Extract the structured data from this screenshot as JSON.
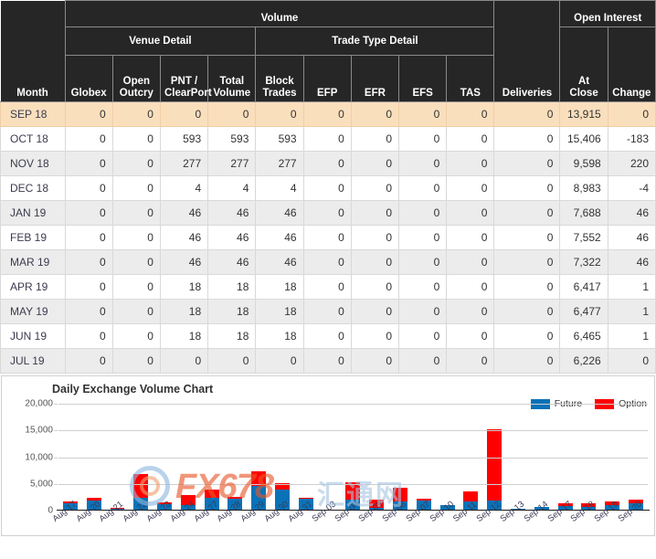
{
  "table": {
    "group_headers": {
      "volume": "Volume",
      "open_interest": "Open Interest",
      "venue_detail": "Venue Detail",
      "trade_type_detail": "Trade Type Detail"
    },
    "columns": [
      "Month",
      "Globex",
      "Open Outcry",
      "PNT / ClearPort",
      "Total Volume",
      "Block Trades",
      "EFP",
      "EFR",
      "EFS",
      "TAS",
      "Deliveries",
      "At Close",
      "Change"
    ],
    "rows": [
      {
        "style": "hl",
        "cells": [
          "SEP 18",
          "0",
          "0",
          "0",
          "0",
          "0",
          "0",
          "0",
          "0",
          "0",
          "0",
          "13,915",
          "0"
        ]
      },
      {
        "style": "even",
        "cells": [
          "OCT 18",
          "0",
          "0",
          "593",
          "593",
          "593",
          "0",
          "0",
          "0",
          "0",
          "0",
          "15,406",
          "-183"
        ]
      },
      {
        "style": "odd",
        "cells": [
          "NOV 18",
          "0",
          "0",
          "277",
          "277",
          "277",
          "0",
          "0",
          "0",
          "0",
          "0",
          "9,598",
          "220"
        ]
      },
      {
        "style": "even",
        "cells": [
          "DEC 18",
          "0",
          "0",
          "4",
          "4",
          "4",
          "0",
          "0",
          "0",
          "0",
          "0",
          "8,983",
          "-4"
        ]
      },
      {
        "style": "odd",
        "cells": [
          "JAN 19",
          "0",
          "0",
          "46",
          "46",
          "46",
          "0",
          "0",
          "0",
          "0",
          "0",
          "7,688",
          "46"
        ]
      },
      {
        "style": "even",
        "cells": [
          "FEB 19",
          "0",
          "0",
          "46",
          "46",
          "46",
          "0",
          "0",
          "0",
          "0",
          "0",
          "7,552",
          "46"
        ]
      },
      {
        "style": "odd",
        "cells": [
          "MAR 19",
          "0",
          "0",
          "46",
          "46",
          "46",
          "0",
          "0",
          "0",
          "0",
          "0",
          "7,322",
          "46"
        ]
      },
      {
        "style": "even",
        "cells": [
          "APR 19",
          "0",
          "0",
          "18",
          "18",
          "18",
          "0",
          "0",
          "0",
          "0",
          "0",
          "6,417",
          "1"
        ]
      },
      {
        "style": "odd",
        "cells": [
          "MAY 19",
          "0",
          "0",
          "18",
          "18",
          "18",
          "0",
          "0",
          "0",
          "0",
          "0",
          "6,477",
          "1"
        ]
      },
      {
        "style": "even",
        "cells": [
          "JUN 19",
          "0",
          "0",
          "18",
          "18",
          "18",
          "0",
          "0",
          "0",
          "0",
          "0",
          "6,465",
          "1"
        ]
      },
      {
        "style": "odd",
        "cells": [
          "JUL 19",
          "0",
          "0",
          "0",
          "0",
          "0",
          "0",
          "0",
          "0",
          "0",
          "0",
          "6,226",
          "0"
        ]
      }
    ]
  },
  "chart_data": {
    "type": "bar",
    "title": "Daily Exchange Volume Chart",
    "stacked": true,
    "xlabel": "",
    "ylabel": "",
    "ylim": [
      0,
      20000
    ],
    "yticks": [
      0,
      5000,
      10000,
      15000,
      20000
    ],
    "ytick_labels": [
      "0",
      "5,000",
      "10,000",
      "15,000",
      "20,000"
    ],
    "grid": true,
    "legend_position": "top-right",
    "legend": [
      {
        "name": "Future",
        "color": "#0a72b8"
      },
      {
        "name": "Option",
        "color": "#ff0000"
      }
    ],
    "categories": [
      "Aug 17",
      "Aug 20",
      "Aug 21",
      "Aug 22",
      "Aug 23",
      "Aug 24",
      "Aug 27",
      "Aug 28",
      "Aug 29",
      "Aug 30",
      "Aug 31",
      "Sep 03",
      "Sep 04",
      "Sep 05",
      "Sep 06",
      "Sep 07",
      "Sep 10",
      "Sep 11",
      "Sep 12",
      "Sep 13",
      "Sep 14",
      "Sep 17",
      "Sep 18",
      "Sep 19",
      "Sep 20"
    ],
    "series": [
      {
        "name": "Future",
        "color": "#0a72b8",
        "values": [
          1200,
          1650,
          120,
          2250,
          1000,
          900,
          2250,
          2050,
          4500,
          3700,
          2050,
          0,
          1950,
          400,
          1550,
          1700,
          800,
          1500,
          1650,
          100,
          500,
          700,
          550,
          800,
          1150
        ]
      },
      {
        "name": "Option",
        "color": "#ff0000",
        "values": [
          400,
          550,
          250,
          4400,
          450,
          1800,
          1450,
          300,
          2600,
          1300,
          150,
          0,
          3150,
          1450,
          2550,
          350,
          0,
          2000,
          13350,
          100,
          100,
          450,
          600,
          700,
          800
        ]
      }
    ]
  },
  "watermark": {
    "brand": "FX678",
    "site": "汇通网"
  }
}
